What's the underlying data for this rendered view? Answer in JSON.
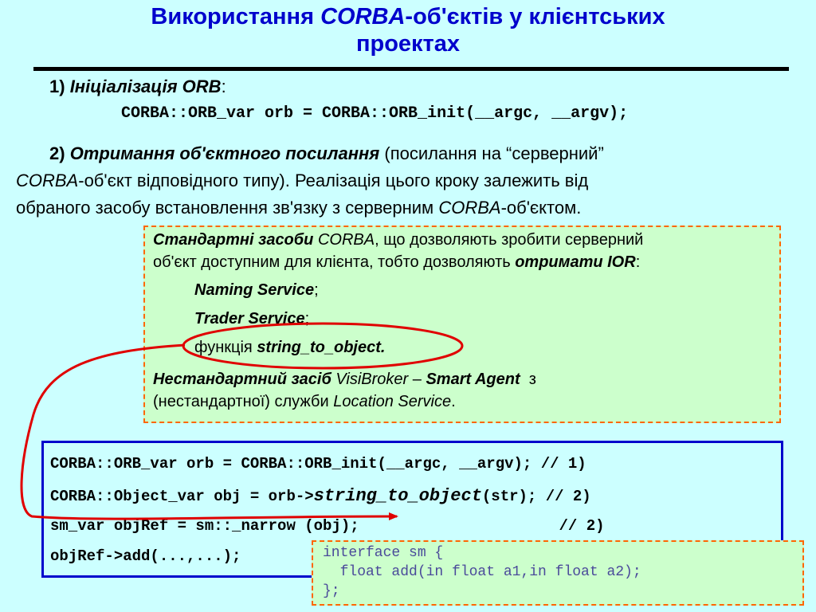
{
  "title": {
    "line1_pre": "Використання ",
    "line1_em": "CORBA",
    "line1_post": "-об'єктів у клієнтських",
    "line2": "проектах"
  },
  "step1": {
    "num": "1) ",
    "label": "Ініціалізація ORB",
    "colon": ":",
    "code": "CORBA::ORB_var orb = CORBA::ORB_init(__argc, __argv);"
  },
  "step2": {
    "num": "2) ",
    "label": "Отримання об'єктного посилання",
    "l1_rest": " (посилання на “серверний”",
    "l2_em": "CORBA",
    "l2_rest": "-об'єкт відповідного типу). Реалізація цього кроку залежить від",
    "l3_pre": "обраного засобу встановлення зв'язку з серверним ",
    "l3_em": "CORBA",
    "l3_post": "-об'єктом."
  },
  "standard_box": {
    "p1_bold": "Стандартні засоби",
    "p1_em": " CORBA",
    "p1_rest": ", що дозволяють зробити серверний",
    "p2_pre": "об'єкт доступним для клієнта, тобто дозволяють ",
    "p2_bold": "отримати IOR",
    "p2_post": ":",
    "item1": "Naming Service",
    "item1_sep": ";",
    "item2": "Trader Service",
    "item2_sep": ";",
    "item3_pre": "функція ",
    "item3": "string_to_object.",
    "ns_bold": "Нестандартний засіб",
    "ns_em": " VisiBroker",
    "ns_dash": " – ",
    "ns_bold2": "Smart Agent",
    "ns_rest": "  з",
    "ns2_pre": "(нестандартної) служби ",
    "ns2_em": "Location Service",
    "ns2_post": "."
  },
  "code_box": {
    "line1": "CORBA::ORB_var orb = CORBA::ORB_init(__argc, __argv); // 1)",
    "line2_pre": "CORBA::Object_var obj = orb->",
    "line2_em": "string_to_object",
    "line2_post": "(str); // 2)",
    "line3": "sm_var objRef = sm::_narrow (obj);                      // 2)",
    "line4": "objRef->add(...,...);"
  },
  "idl_box": {
    "line1": "interface sm {",
    "line2": "  float add(in float a1,in float a2);",
    "line3": "};"
  },
  "colors": {
    "background": "#ccffff",
    "title": "#0000cc",
    "box_fill": "#ccffcc",
    "dashed_border": "#ff6600",
    "code_border": "#0000cc",
    "annotation": "#e00000"
  }
}
